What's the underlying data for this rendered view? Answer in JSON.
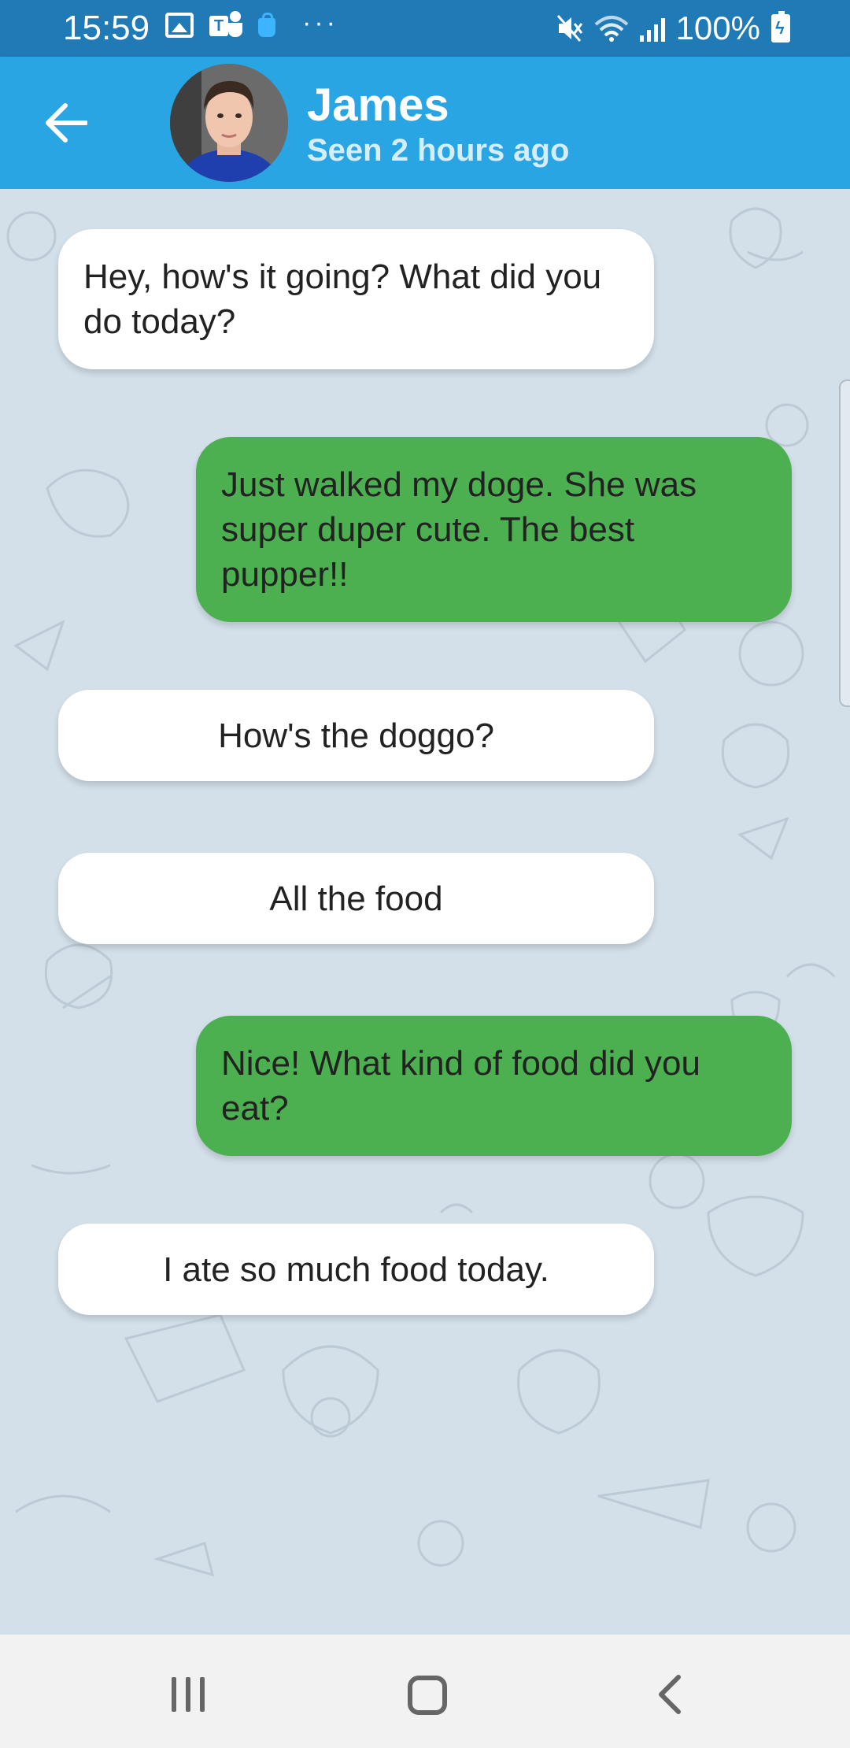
{
  "status_bar": {
    "time": "15:59",
    "teams_letter": "T",
    "more_dots": "···",
    "mute_glyph": "🔇",
    "battery_text": "100%",
    "icons": [
      "gallery-icon",
      "teams-icon",
      "shopping-bag-icon",
      "more-icon",
      "mute-icon",
      "wifi-icon",
      "signal-icon",
      "battery-charging-icon"
    ]
  },
  "header": {
    "back_icon": "arrow-left-icon",
    "contact_name": "James",
    "contact_status": "Seen 2 hours ago",
    "color": "#29a5e3"
  },
  "messages": [
    {
      "side": "incoming",
      "text": "Hey, how's it going? What did you do today?"
    },
    {
      "side": "outgoing",
      "text": "Just walked my doge. She was super duper cute. The best pupper!!"
    },
    {
      "side": "option",
      "text": "How's the doggo?"
    },
    {
      "side": "option",
      "text": "All the food"
    },
    {
      "side": "outgoing",
      "text": "Nice! What kind of food did you eat?"
    },
    {
      "side": "option",
      "text": "I ate so much food today."
    }
  ],
  "colors": {
    "status_bar": "#1f7ab5",
    "outgoing_bubble": "#4caf50",
    "incoming_bubble": "#ffffff",
    "chat_background": "#d3dfe9"
  },
  "nav_bar": {
    "icons": [
      "recent-apps-icon",
      "home-icon",
      "back-icon"
    ]
  }
}
